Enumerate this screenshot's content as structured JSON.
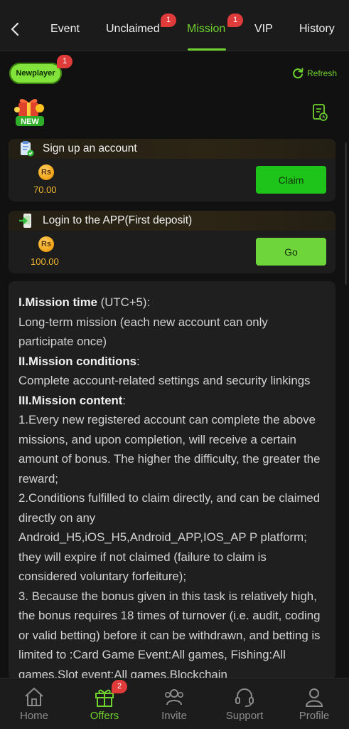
{
  "nav": {
    "tabs": [
      {
        "label": "Event"
      },
      {
        "label": "Unclaimed",
        "badge": "1"
      },
      {
        "label": "Mission",
        "badge": "1",
        "active": true
      },
      {
        "label": "VIP"
      },
      {
        "label": "History"
      }
    ]
  },
  "filter": {
    "chip_label": "Newplayer",
    "chip_badge": "1",
    "refresh_label": "Refresh"
  },
  "new_tag": "NEW",
  "missions": [
    {
      "title": "Sign up an account",
      "currency": "Rs",
      "amount": "70.00",
      "button": "Claim"
    },
    {
      "title": "Login to the APP(First deposit)",
      "currency": "Rs",
      "amount": "100.00",
      "button": "Go"
    }
  ],
  "rules": {
    "s1_title": "I.Mission time",
    "s1_tz": "(UTC+5):",
    "s1_body": "Long-term mission (each new account can only participate once)",
    "s2_title": "II.Mission conditions",
    "s2_colon": ":",
    "s2_body": "Complete account-related settings and security linkings",
    "s3_title": "III.Mission content",
    "s3_colon": ":",
    "p1": "1.Every new registered account can complete the above missions, and upon completion, will receive a certain amount of bonus. The higher the difficulty, the greater the reward;",
    "p2": "2.Conditions fulfilled to claim directly, and can be claimed directly on any Android_H5,iOS_H5,Android_APP,IOS_AP P platform; they will expire if not claimed (failure to claim is considered voluntary forfeiture);",
    "p3": "3. Because the bonus given in this task is relatively high, the bonus requires 18 times of turnover (i.e. audit, coding or valid betting) before it can be withdrawn, and betting is limited to :Card Game Event:All games, Fishing:All games,Slot event:All games,Blockchain"
  },
  "bottom": {
    "items": [
      {
        "label": "Home"
      },
      {
        "label": "Offers",
        "badge": "2",
        "active": true
      },
      {
        "label": "Invite"
      },
      {
        "label": "Support"
      },
      {
        "label": "Profile"
      }
    ]
  },
  "colors": {
    "accent": "#6fd22f",
    "badge": "#e03b3b",
    "coin": "#f4a81c",
    "background": "#111111"
  }
}
